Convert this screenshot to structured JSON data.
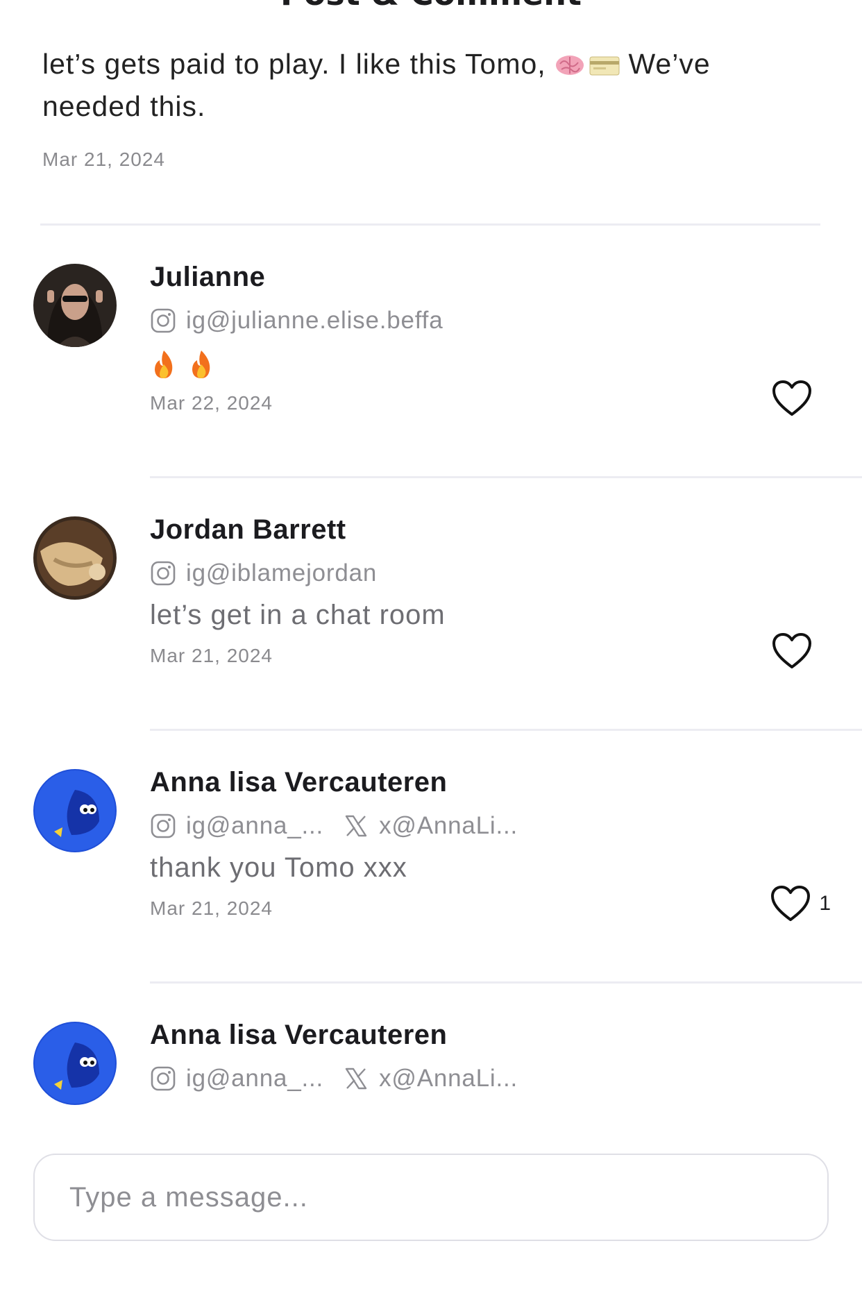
{
  "header": {
    "title": "Post & Comment"
  },
  "post": {
    "text_before": "let’s gets paid to play. I like this Tomo, ",
    "emojis": [
      "brain-emoji",
      "credit-card-emoji"
    ],
    "text_after": " We’ve needed this.",
    "date": "Mar 21, 2024"
  },
  "comments": [
    {
      "name": "Julianne",
      "ig": "ig@julianne.elise.beffa",
      "x": "",
      "text": "",
      "text_emojis": [
        "fire-emoji",
        "fire-emoji"
      ],
      "date": "Mar 22, 2024",
      "likes": ""
    },
    {
      "name": "Jordan Barrett",
      "ig": "ig@iblamejordan",
      "x": "",
      "text": "let’s get in a chat room",
      "date": "Mar 21, 2024",
      "likes": ""
    },
    {
      "name": "Anna lisa Vercauteren",
      "ig": "ig@anna_...",
      "x": "x@AnnaLi...",
      "text": "thank you Tomo xxx",
      "date": "Mar 21, 2024",
      "likes": "1"
    },
    {
      "name": "Anna lisa Vercauteren",
      "ig": "ig@anna_...",
      "x": "x@AnnaLi...",
      "text": "",
      "date": "",
      "likes": ""
    }
  ],
  "composer": {
    "placeholder": "Type a message..."
  },
  "colors": {
    "text_primary": "#1c1c1e",
    "text_secondary": "#8e8e93",
    "divider": "#ececf2",
    "avatar_blue": "#1f4fd8"
  }
}
